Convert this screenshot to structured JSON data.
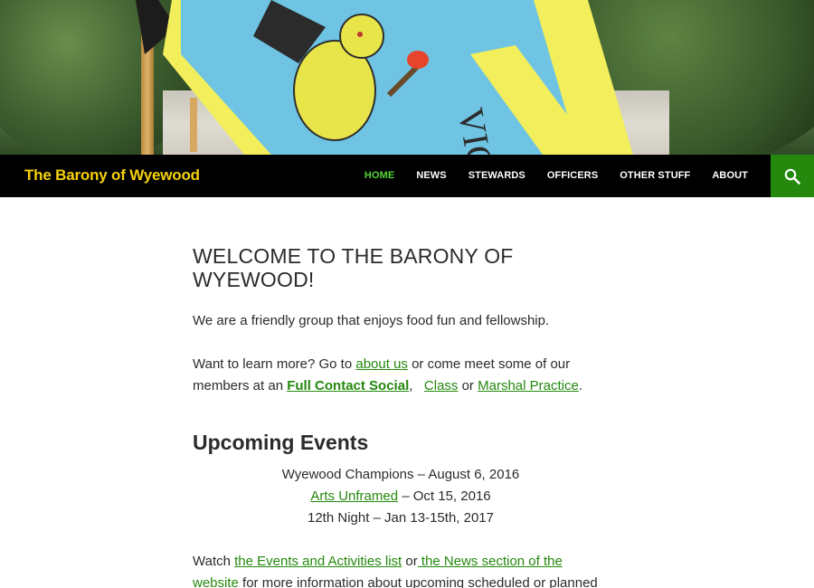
{
  "site": {
    "title": "The Barony of Wyewood"
  },
  "nav": {
    "items": [
      {
        "label": "HOME",
        "current": true
      },
      {
        "label": "NEWS"
      },
      {
        "label": "STEWARDS"
      },
      {
        "label": "OFFICERS"
      },
      {
        "label": "OTHER STUFF"
      },
      {
        "label": "ABOUT"
      }
    ],
    "search_icon": "search-icon"
  },
  "article": {
    "title": "WELCOME TO THE BARONY OF WYEWOOD!",
    "intro": "We are a friendly group that enjoys food fun and fellowship.",
    "learn": {
      "pre": "Want to learn more? Go to ",
      "about_link": "about us",
      "mid1": " or come meet some of our members at an ",
      "social_link": "Full Contact Social",
      "sep": ",   ",
      "class_link": "Class",
      "mid2": " or ",
      "marshal_link": "Marshal Practice",
      "end": "."
    },
    "events_heading": "Upcoming Events",
    "events": {
      "e1": "Wyewood Champions – August 6, 2016",
      "e2_link": "Arts Unframed",
      "e2_rest": " – Oct 15, 2016",
      "e3": "12th Night – Jan 13-15th, 2017"
    },
    "watch": {
      "pre": "Watch ",
      "events_link": "the Events and Activities list",
      "mid": " or",
      "news_link": " the News section of the website",
      "rest": " for more information about upcoming scheduled or planned"
    }
  },
  "colors": {
    "accent": "#24890d",
    "nav_current": "#55d737",
    "title": "#f5d10a",
    "header_bg": "#000000"
  }
}
